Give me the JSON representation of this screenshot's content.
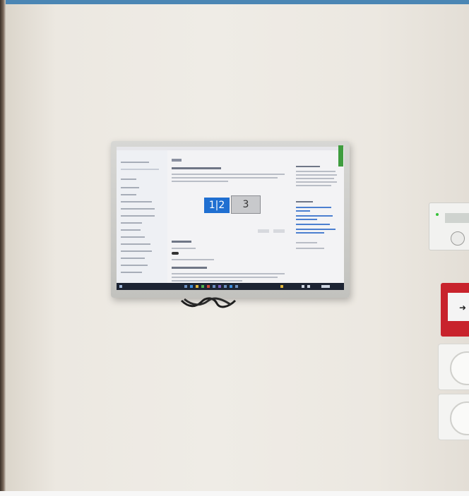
{
  "screen": {
    "display_tile_primary": "1|2",
    "display_tile_secondary": "3"
  },
  "colors": {
    "wall": "#efece6",
    "bezel": "#cacac6",
    "windows_accent": "#1f6fd1",
    "taskbar": "#1d2433",
    "fire_alarm_red": "#c8232c",
    "frame_top": "#4b86b4"
  },
  "icons": [
    "monitor-icon",
    "thermostat-icon",
    "fire-alarm-icon",
    "power-outlet-icon",
    "cable-icon"
  ]
}
